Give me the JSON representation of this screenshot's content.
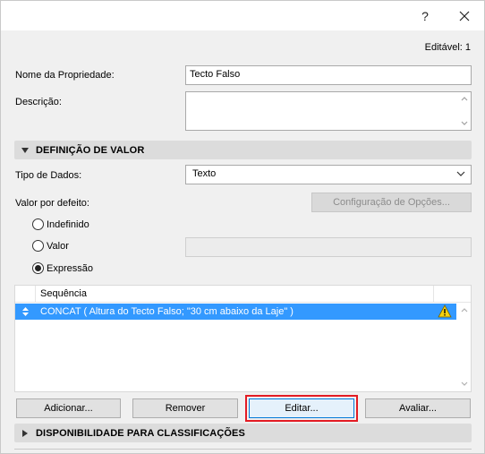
{
  "titlebar": {
    "help_label": "?",
    "close_icon": "close-icon"
  },
  "editable_label": "Editável: 1",
  "property_name": {
    "label": "Nome da Propriedade:",
    "value": "Tecto Falso"
  },
  "description": {
    "label": "Descrição:",
    "value": ""
  },
  "value_definition": {
    "header": "DEFINIÇÃO DE VALOR"
  },
  "data_type": {
    "label": "Tipo de Dados:",
    "selected": "Texto"
  },
  "default_value": {
    "label": "Valor por defeito:",
    "options_button": "Configuração de Opções..."
  },
  "radios": [
    {
      "label": "Indefinido",
      "checked": false
    },
    {
      "label": "Valor",
      "checked": false
    },
    {
      "label": "Expressão",
      "checked": true
    }
  ],
  "expression_list": {
    "column_header": "Sequência",
    "rows": [
      {
        "text": "CONCAT ( Altura do Tecto Falso; \"30 cm abaixo da Laje\" )",
        "warning": true,
        "selected": true
      }
    ]
  },
  "buttons": {
    "add": "Adicionar...",
    "remove": "Remover",
    "edit": "Editar...",
    "evaluate": "Avaliar..."
  },
  "classification": {
    "header": "DISPONIBILIDADE PARA CLASSIFICAÇÕES"
  },
  "colors": {
    "selection": "#3399ff",
    "highlight": "#e31b23",
    "warning": "#f5d10f"
  }
}
